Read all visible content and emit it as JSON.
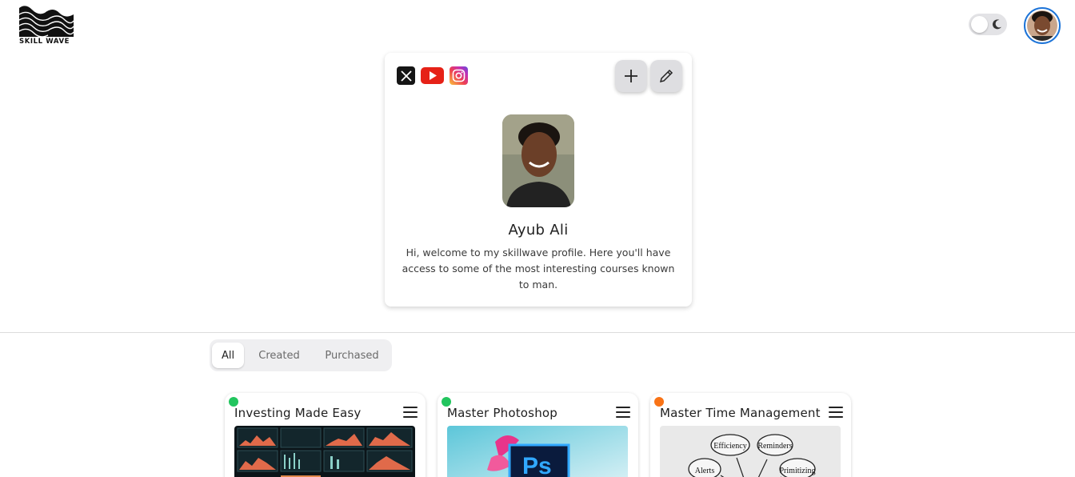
{
  "header": {
    "logo_text": "SKILL WAVE"
  },
  "profile": {
    "name": "Ayub Ali",
    "bio": "Hi, welcome to my skillwave profile. Here you'll have access to some of the most interesting courses known to man.",
    "socials": [
      "x-icon",
      "youtube-icon",
      "instagram-icon"
    ]
  },
  "tabs": [
    {
      "label": "All",
      "active": true
    },
    {
      "label": "Created",
      "active": false
    },
    {
      "label": "Purchased",
      "active": false
    }
  ],
  "courses": [
    {
      "title": "Investing Made Easy",
      "status_color": "#22c55e"
    },
    {
      "title": "Master Photoshop",
      "status_color": "#22c55e"
    },
    {
      "title": "Master Time Management",
      "status_color": "#f97316"
    }
  ],
  "thumb_labels": {
    "photoshop": "Ps",
    "bubble1": "Efficiency",
    "bubble2": "Reminders",
    "bubble3": "Alerts",
    "bubble4": "Primitizing"
  },
  "colors": {
    "accent": "#1d74d8",
    "youtube": "#e62117"
  }
}
